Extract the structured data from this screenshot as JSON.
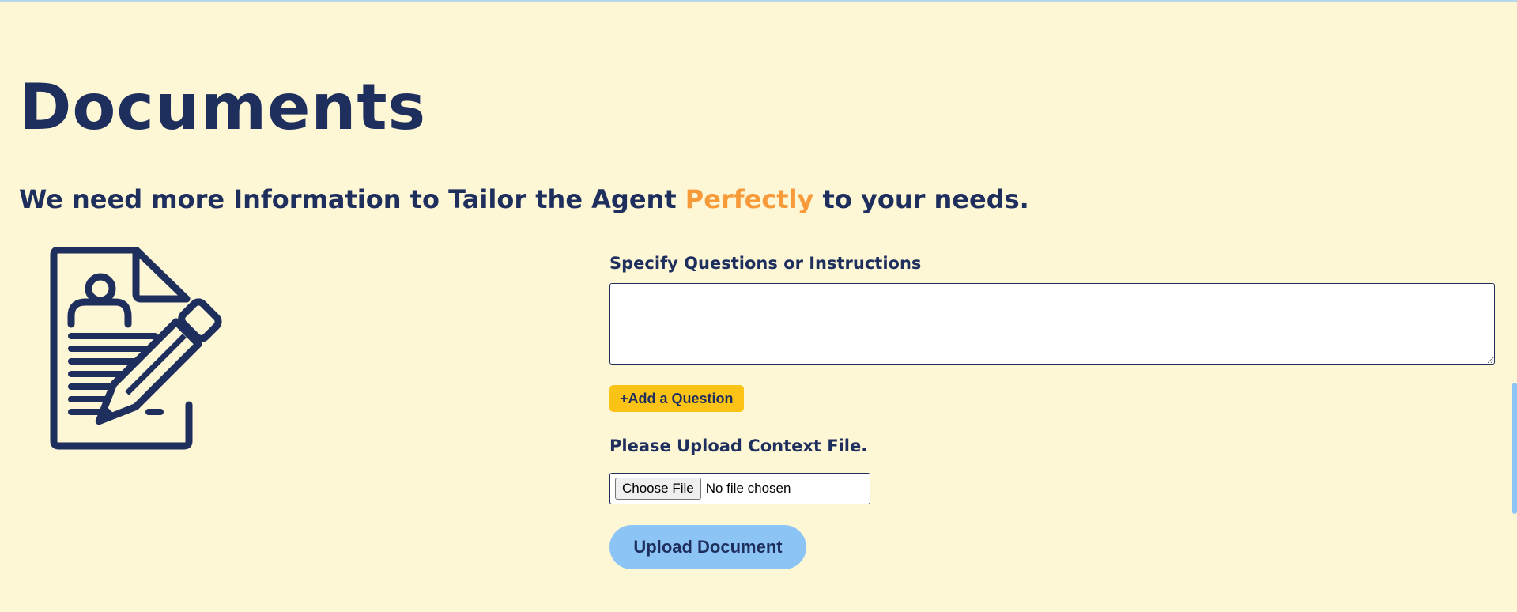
{
  "header": {
    "title": "Documents",
    "subtitle_before": "We need more Information to Tailor the Agent",
    "subtitle_accent": "Perfectly",
    "subtitle_after": "to your needs."
  },
  "form": {
    "questions_label": "Specify Questions or Instructions",
    "questions_value": "",
    "add_question_label": "+Add a Question",
    "upload_label": "Please Upload Context File.",
    "choose_file_label": "Choose File",
    "file_status": "No file chosen",
    "upload_button_label": "Upload Document"
  },
  "illustration": {
    "icon": "document-edit-icon"
  },
  "colors": {
    "background": "#fef7d6",
    "text": "#1e2f5e",
    "accent": "#f79a3a",
    "add_button": "#fbc316",
    "upload_button": "#8cc4f6"
  }
}
